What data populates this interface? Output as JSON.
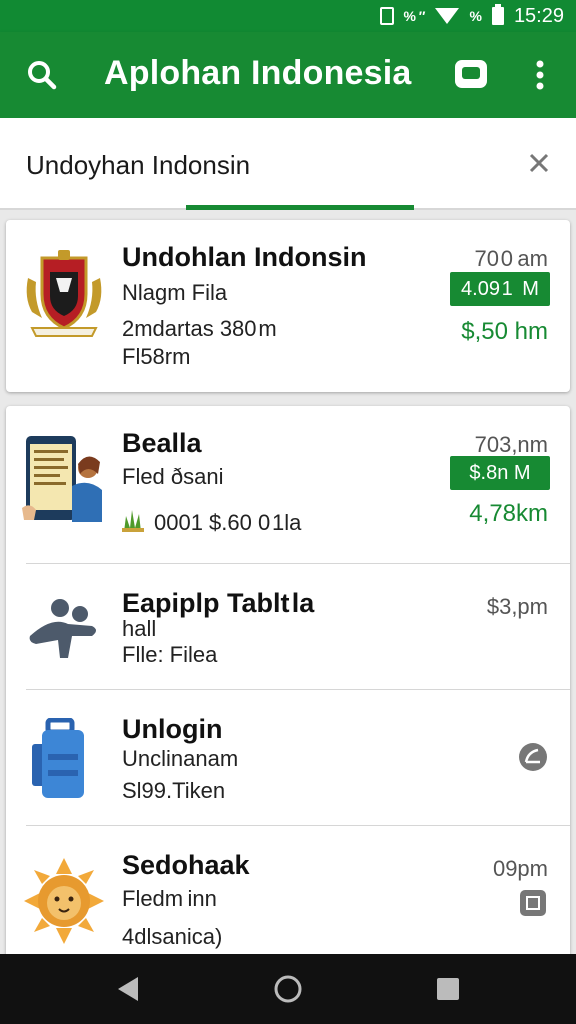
{
  "status_bar": {
    "signal": "% ″",
    "time": "15:29",
    "battery_pct": "%"
  },
  "app_bar": {
    "title": "Aplohan Indonesia"
  },
  "search": {
    "query": "Undoyhan Indonsin"
  },
  "colors": {
    "primary": "#178a33",
    "accent_text": "#178a33"
  },
  "results": [
    {
      "title": "Undohlan Indonsin",
      "line1": "Nlagm Fila",
      "line2": "2mdartas 380 m",
      "line3": "Fl58rm",
      "time": "70 0 am",
      "badge": "4.09 1  M",
      "distance": "$,50 hm",
      "icon": "indonesia-emblem-icon"
    },
    {
      "title": "Bealla",
      "line1": "Fled ðsani",
      "line2": "0001 $.60 0 1la",
      "time": "703,nm",
      "badge": "$.8n M",
      "distance": "4,78km",
      "icon": "tablet-reader-icon",
      "line2_icon": "grass-icon"
    },
    {
      "title": "Eapiplp Tablt la",
      "subtitle": "hall",
      "line1": "Flle: Filea",
      "time": "$3,pm",
      "icon": "people-group-icon"
    },
    {
      "title": "Unlogin",
      "line1": "Unclinanam",
      "line2": "Sl99.Tiken",
      "icon": "luggage-icon",
      "right_icon": "disabled-clock-icon"
    },
    {
      "title": "Sedohaak",
      "line1": "Fledm inn",
      "line2": "4dlsanica)",
      "time": "09pm",
      "icon": "lion-sun-icon",
      "right_icon": "square-box-icon"
    }
  ]
}
